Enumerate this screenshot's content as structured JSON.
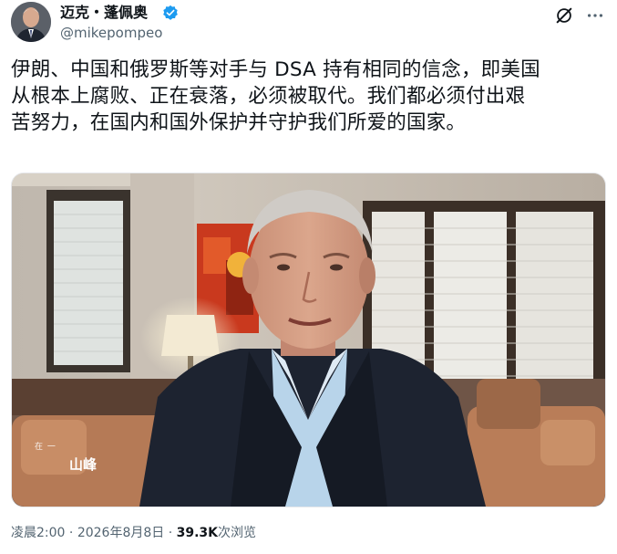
{
  "author": {
    "display_name": "迈克・蓬佩奥",
    "handle": "@mikepompeo",
    "verified": true
  },
  "header_icons": [
    "grok-icon",
    "more-options-icon"
  ],
  "tweet": {
    "text_lines": [
      "伊朗、中国和俄罗斯等对手与 DSA 持有相同的信念，即美国",
      "从根本上腐败、正在衰落，必须被取代。我们都必须付出艰",
      "苦努力，在国内和国外保护并守护我们所爱的国家。"
    ]
  },
  "media": {
    "type": "video-frame",
    "watermark": {
      "small": "在  一",
      "big": "山峰"
    }
  },
  "meta": {
    "time": "凌晨2:00",
    "date": "2026年8月8日",
    "views_count": "39.3K",
    "views_label": "次浏览",
    "separator": "·"
  },
  "colors": {
    "text": "#0f1419",
    "secondary": "#536471",
    "verified_blue": "#1d9bf0"
  }
}
